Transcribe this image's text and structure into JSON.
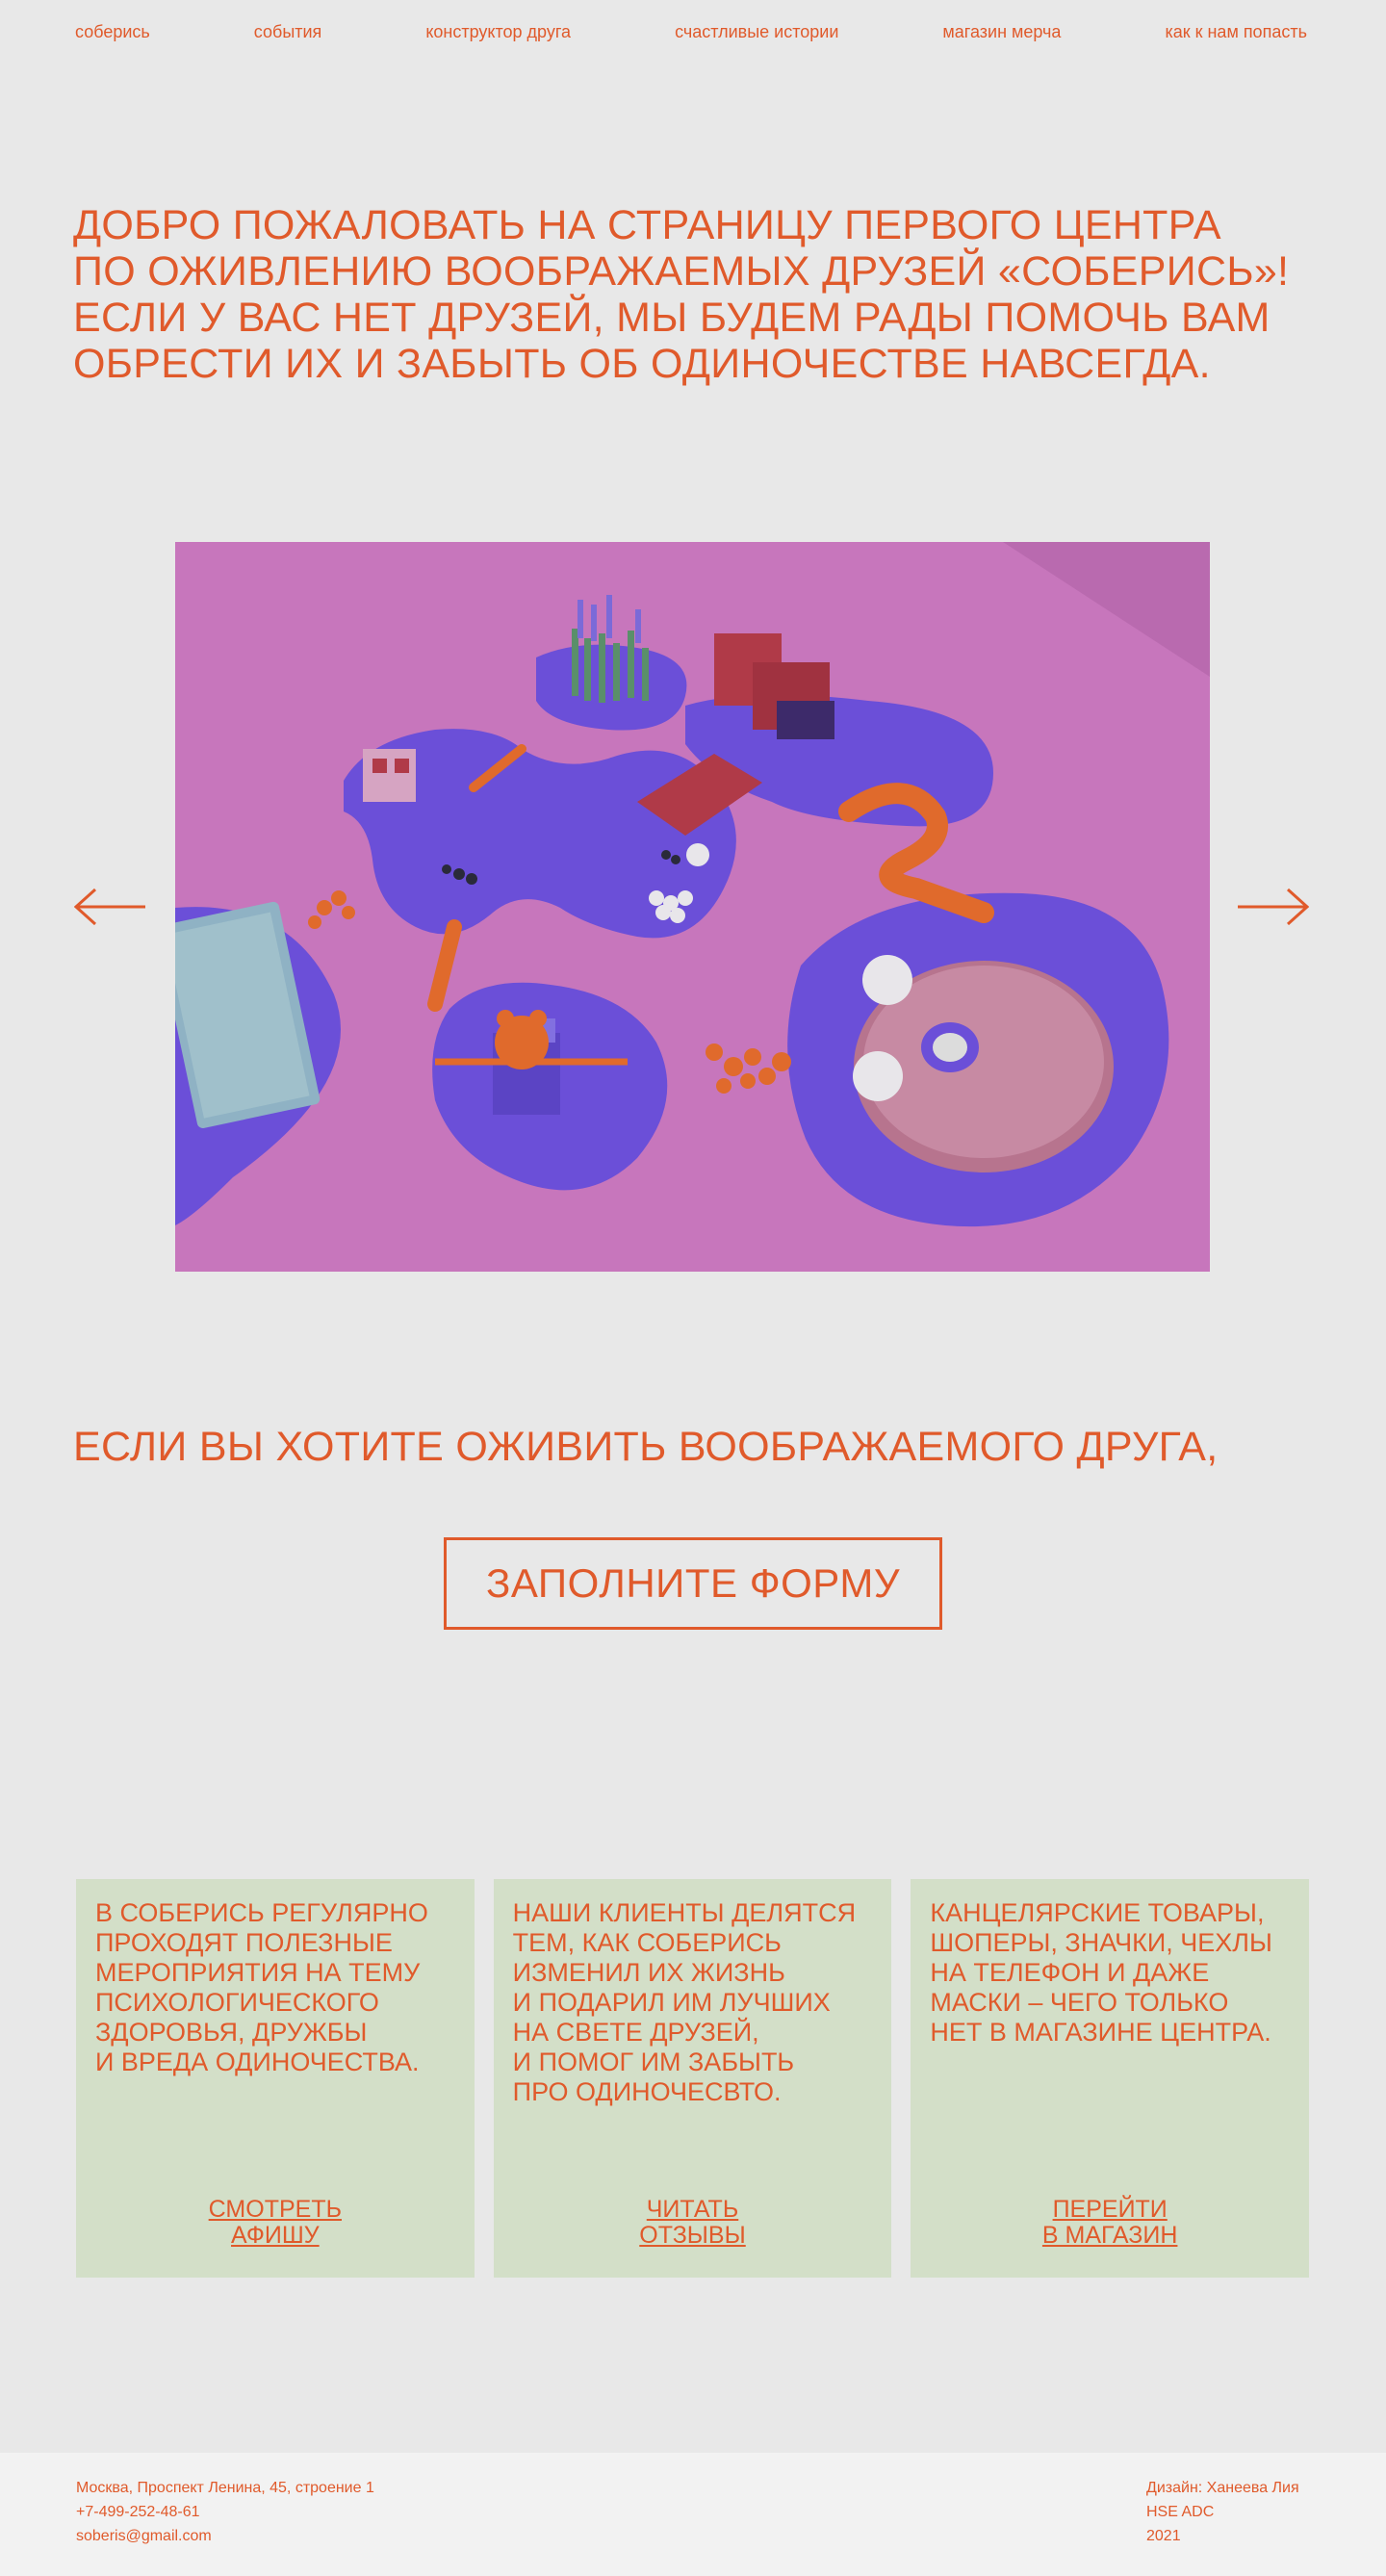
{
  "nav": {
    "items": [
      {
        "label": "соберись"
      },
      {
        "label": "события"
      },
      {
        "label": "конструктор друга"
      },
      {
        "label": "счастливые истории"
      },
      {
        "label": "магазин мерча"
      },
      {
        "label": "как к нам попасть"
      }
    ]
  },
  "hero": {
    "lines": [
      "Добро пожаловать на страницу первого центра",
      "по оживлению воображаемых друзей «Соберись»!",
      "Если у вас нет друзей, мы будем рады помочь вам",
      "обрести их и забыть об одиночестве навсегда."
    ]
  },
  "gallery": {
    "prev_icon": "arrow-left-icon",
    "next_icon": "arrow-right-icon",
    "colors": {
      "background": "#c776bc",
      "platform": "#6b4fd8",
      "accent": "#e06a2c",
      "red": "#b03a48"
    }
  },
  "cta": {
    "text": "Если вы хотите оживить воображаемого друга,",
    "button_label": "заполните форму"
  },
  "cards": [
    {
      "text": "В Соберись регулярно\nпроходят полезные\nмероприятия на тему\nпсихологического\nздоровья, дружбы\nи вреда одиночества.",
      "link": "смотреть\nафишу"
    },
    {
      "text": "Наши клиенты делятся\nтем, как Соберись\nизменил их жизнь\nи подарил им лучших\nна свете друзей,\nи помог им забыть\nпро одиночесвто.",
      "link": "читать\nотзывы"
    },
    {
      "text": "Канцелярские товары,\nшоперы, значки, чехлы\nна телефон и даже\nмаски – чего только\nнет в магазине центра.",
      "link": "перейти\nв магазин"
    }
  ],
  "footer": {
    "address": "Москва, Проспект Ленина, 45, строение 1",
    "phone": "+7-499-252-48-61",
    "email": "soberis@gmail.com",
    "design": "Дизайн: Ханеева Лия",
    "school": "HSE ADC",
    "year": "2021"
  },
  "colors": {
    "accent": "#e05a2b",
    "page_bg": "#e8e8e8",
    "card_bg": "#d3dfc8",
    "footer_bg": "#f2f2f2"
  }
}
